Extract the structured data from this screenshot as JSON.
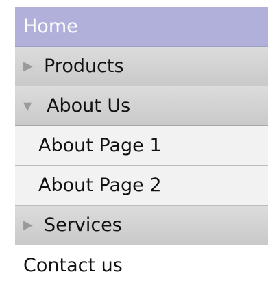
{
  "menu": {
    "home": "Home",
    "products": "Products",
    "about_us": "About Us",
    "about_page_1": "About Page 1",
    "about_page_2": "About Page 2",
    "services": "Services",
    "contact_us": "Contact us"
  },
  "icons": {
    "collapsed": "triangle-right-icon",
    "expanded": "triangle-down-icon"
  },
  "colors": {
    "home_background": "#b1b0db",
    "group_background": "#d3d3d3",
    "submenu_background": "#f2f2f2"
  }
}
